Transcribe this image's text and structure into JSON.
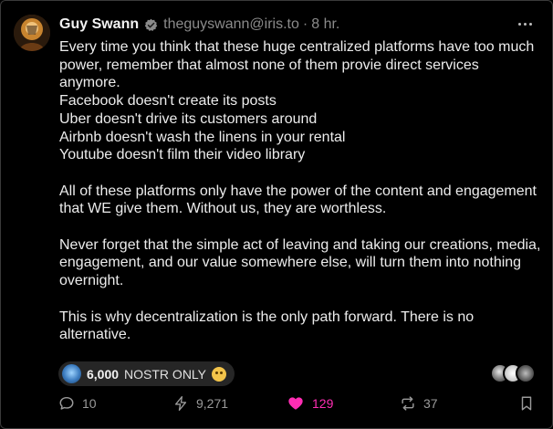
{
  "post": {
    "author_name": "Guy Swann",
    "handle": "theguyswann@iris.to",
    "separator": "·",
    "time": "8 hr.",
    "paragraphs": [
      [
        "Every time you think that these huge centralized platforms have too much power, remember that almost none of them provie direct services anymore.",
        "Facebook doesn't create its posts",
        "Uber doesn't drive its customers around",
        "Airbnb doesn't wash the linens in your rental",
        "Youtube doesn't film their video library"
      ],
      [
        "All of these platforms only have the power of the content and engagement that WE give them. Without us, they are worthless."
      ],
      [
        "Never forget that the simple act of leaving and taking our creations, media, engagement, and our value somewhere else, will turn them into nothing overnight."
      ],
      [
        "This is why decentralization is the only path forward. There is no alternative."
      ]
    ]
  },
  "top_zap": {
    "amount": "6,000",
    "message": "NOSTR ONLY"
  },
  "actions": {
    "replies": "10",
    "zaps": "9,271",
    "likes": "129",
    "reposts": "37"
  },
  "colors": {
    "background": "#000000",
    "text": "#ececec",
    "muted": "#8b8b8b",
    "like_accent": "#ff2db3",
    "pill_bg": "#262626"
  },
  "icons": {
    "verified": "verified-badge-icon",
    "more": "more-options-icon",
    "reply": "comment-icon",
    "zap": "lightning-icon",
    "like": "heart-icon",
    "repost": "repost-icon",
    "bookmark": "bookmark-icon"
  }
}
